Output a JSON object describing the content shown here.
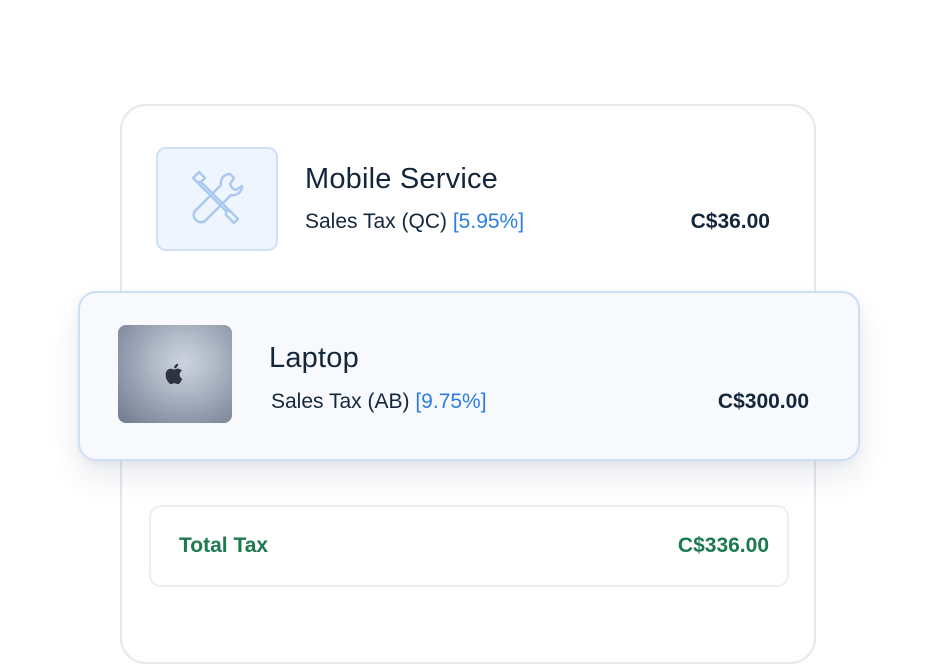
{
  "items": [
    {
      "name": "Mobile Service",
      "tax_label": "Sales Tax (QC)",
      "tax_rate": "[5.95%]",
      "amount": "C$36.00",
      "icon": "wrench-screwdriver-icon"
    },
    {
      "name": "Laptop",
      "tax_label": "Sales Tax (AB)",
      "tax_rate": "[9.75%]",
      "amount": "C$300.00",
      "icon": "apple-logo-icon"
    }
  ],
  "total": {
    "label": "Total Tax",
    "amount": "C$336.00"
  },
  "colors": {
    "rate_blue": "#2b7de0",
    "total_green": "#1c7a4f",
    "text_dark": "#13263b",
    "icon_blue": "#a9c8f0"
  }
}
